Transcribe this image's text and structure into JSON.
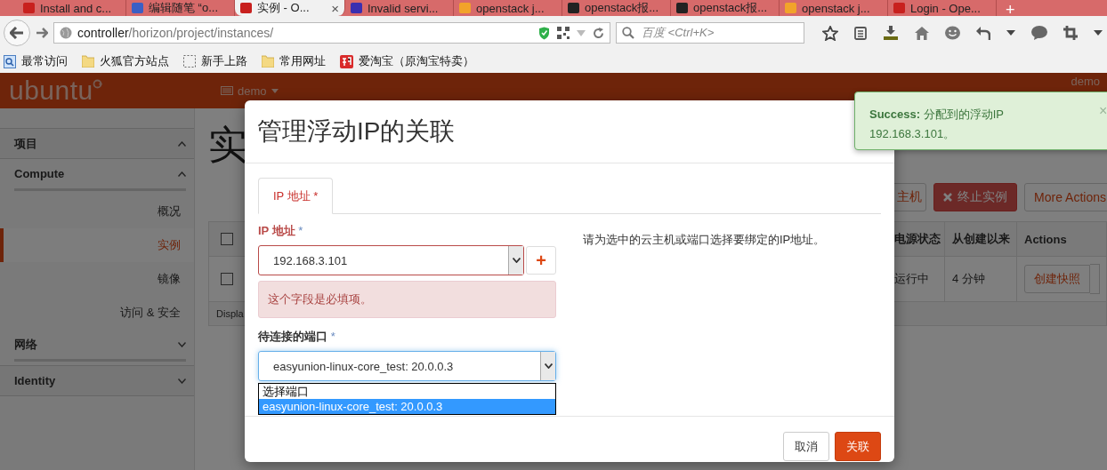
{
  "browser": {
    "tabs": [
      {
        "title": "Install and c...",
        "selected": false,
        "kind": "openstack"
      },
      {
        "title": "编辑随笔 “o...",
        "selected": false,
        "kind": "blog"
      },
      {
        "title": "实例 - O...",
        "selected": true,
        "kind": "openstack",
        "close": "×"
      },
      {
        "title": "Invalid servi...",
        "selected": false,
        "kind": "error"
      },
      {
        "title": "openstack j...",
        "selected": false,
        "kind": "favorite"
      },
      {
        "title": "openstack报...",
        "selected": false,
        "kind": "article"
      },
      {
        "title": "openstack报...",
        "selected": false,
        "kind": "article"
      },
      {
        "title": "openstack j...",
        "selected": false,
        "kind": "favorite"
      },
      {
        "title": "Login - Ope...",
        "selected": false,
        "kind": "openstack"
      }
    ],
    "new_tab": "+",
    "address": {
      "host": "controller",
      "path": "/horizon/project/instances/"
    },
    "search": {
      "placeholder": "百度 <Ctrl+K>"
    },
    "bookmarks": [
      {
        "label": "最常访问",
        "kind": "feed"
      },
      {
        "label": "火狐官方站点",
        "kind": "folder"
      },
      {
        "label": "新手上路",
        "kind": "dashed"
      },
      {
        "label": "常用网址",
        "kind": "folder"
      },
      {
        "label": "爱淘宝（原淘宝特卖）",
        "kind": "taobao"
      }
    ]
  },
  "app": {
    "brand": "ubuntu",
    "project": "demo",
    "user": "demo"
  },
  "sidebar": {
    "items": [
      {
        "label": "项目",
        "expanded": true,
        "children": [
          {
            "label": "Compute",
            "expanded": true,
            "children": [
              {
                "label": "概况",
                "selected": false
              },
              {
                "label": "实例",
                "selected": true
              },
              {
                "label": "镜像",
                "selected": false
              },
              {
                "label": "访问 & 安全",
                "selected": false
              }
            ]
          },
          {
            "label": "网络",
            "expanded": false
          }
        ]
      },
      {
        "label": "Identity",
        "expanded": false
      }
    ]
  },
  "page": {
    "title": "实",
    "actions": [
      {
        "label": "主机",
        "kind": "default"
      },
      {
        "label": "终止实例",
        "kind": "danger"
      },
      {
        "label": "More Actions",
        "kind": "dropdown"
      }
    ],
    "table": {
      "columns": [
        "电源状态",
        "从创建以来",
        "Actions"
      ],
      "rows": [
        {
          "checked": false,
          "cells": [
            "运行中",
            "4 分钟"
          ],
          "action": "创建快照"
        }
      ],
      "header_checked": false,
      "footer": "Displa"
    }
  },
  "modal": {
    "title": "管理浮动IP的关联",
    "tabs": [
      {
        "label": "IP 地址 *",
        "selected": true
      }
    ],
    "fields": [
      {
        "label": "IP 地址",
        "required_mark": "*",
        "value": "192.168.3.101",
        "error": "这个字段是必填项。",
        "add": "+",
        "focused": false
      },
      {
        "label": "待连接的端口",
        "required_mark": "*",
        "value": "easyunion-linux-core_test: 20.0.0.3",
        "focused": true,
        "options": [
          {
            "label": "选择端口",
            "selected": false
          },
          {
            "label": "easyunion-linux-core_test: 20.0.0.3",
            "selected": true
          }
        ]
      }
    ],
    "help": "请为选中的云主机或端口选择要绑定的IP地址。",
    "buttons": [
      {
        "label": "取消",
        "kind": "default"
      },
      {
        "label": "关联",
        "kind": "primary"
      }
    ]
  },
  "toast": {
    "message": "**Success:** 分配到的浮动IP",
    "detail": "192.168.3.101。",
    "close": "×"
  }
}
